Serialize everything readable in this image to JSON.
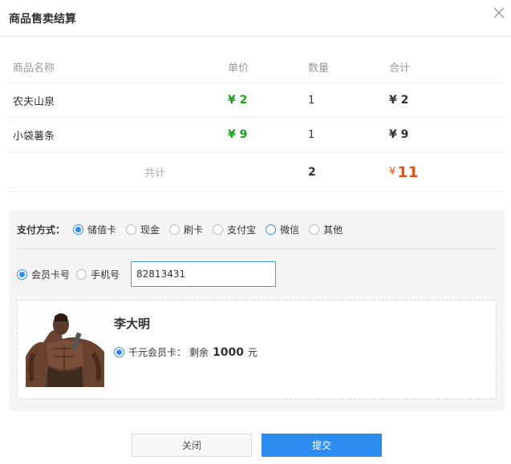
{
  "dialog": {
    "title": "商品售卖结算"
  },
  "table": {
    "headers": [
      "商品名称",
      "单价",
      "数量",
      "合计"
    ],
    "rows": [
      {
        "name": "农夫山泉",
        "price": "¥ 2",
        "qty": "1",
        "total": "¥ 2"
      },
      {
        "name": "小袋薯条",
        "price": "¥ 9",
        "qty": "1",
        "total": "¥ 9"
      }
    ],
    "footer": {
      "label": "共计",
      "qty": "2",
      "currency": "¥",
      "sum": "11"
    }
  },
  "payment": {
    "label": "支付方式：",
    "options": [
      "储值卡",
      "现金",
      "刷卡",
      "支付宝",
      "微信",
      "其他"
    ],
    "selected": "储值卡"
  },
  "lookup": {
    "options": [
      "会员卡号",
      "手机号"
    ],
    "selected": "会员卡号",
    "value": "82813431"
  },
  "member": {
    "name": "李大明",
    "card_label": "千元会员卡：",
    "remain_label": "剩余",
    "balance": "1000",
    "unit": "元"
  },
  "buttons": {
    "close": "关闭",
    "submit": "提交"
  },
  "colors": {
    "accent": "#2d8cf0",
    "price_green": "#1a9e1a",
    "sum_orange": "#e0561e"
  }
}
